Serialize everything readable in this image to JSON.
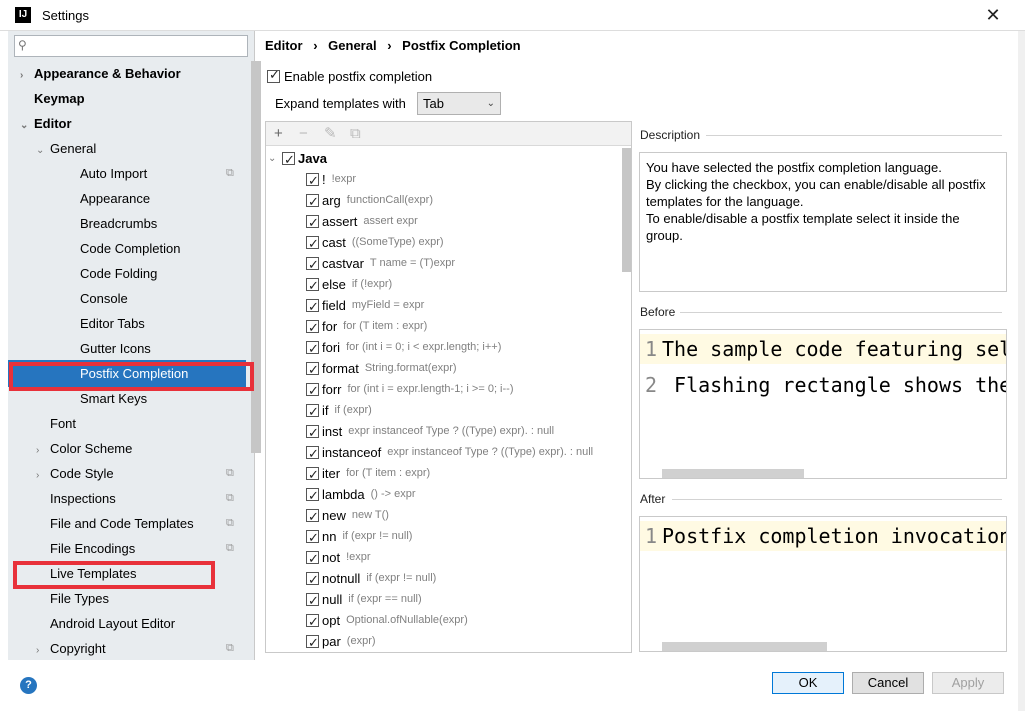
{
  "window": {
    "title": "Settings",
    "app_icon": "IJ",
    "close_label": "✕"
  },
  "search": {
    "placeholder": ""
  },
  "tree": [
    {
      "label": "Appearance & Behavior",
      "bold": true,
      "arrow": "›",
      "level": 0
    },
    {
      "label": "Keymap",
      "bold": true,
      "arrow": "",
      "level": 0
    },
    {
      "label": "Editor",
      "bold": true,
      "arrow": "⌄",
      "level": 0
    },
    {
      "label": "General",
      "bold": false,
      "arrow": "⌄",
      "level": 1
    },
    {
      "label": "Auto Import",
      "level": 2,
      "copy": true
    },
    {
      "label": "Appearance",
      "level": 2
    },
    {
      "label": "Breadcrumbs",
      "level": 2
    },
    {
      "label": "Code Completion",
      "level": 2
    },
    {
      "label": "Code Folding",
      "level": 2
    },
    {
      "label": "Console",
      "level": 2
    },
    {
      "label": "Editor Tabs",
      "level": 2
    },
    {
      "label": "Gutter Icons",
      "level": 2
    },
    {
      "label": "Postfix Completion",
      "level": 2,
      "selected": true
    },
    {
      "label": "Smart Keys",
      "level": 2
    },
    {
      "label": "Font",
      "level": 1
    },
    {
      "label": "Color Scheme",
      "level": 1,
      "arrow": "›"
    },
    {
      "label": "Code Style",
      "level": 1,
      "arrow": "›",
      "copy": true
    },
    {
      "label": "Inspections",
      "level": 1,
      "copy": true
    },
    {
      "label": "File and Code Templates",
      "level": 1,
      "copy": true
    },
    {
      "label": "File Encodings",
      "level": 1,
      "copy": true
    },
    {
      "label": "Live Templates",
      "level": 1
    },
    {
      "label": "File Types",
      "level": 1
    },
    {
      "label": "Android Layout Editor",
      "level": 1
    },
    {
      "label": "Copyright",
      "level": 1,
      "arrow": "›",
      "copy": true
    }
  ],
  "breadcrumb": {
    "part1": "Editor",
    "sep": "›",
    "part2": "General",
    "part3": "Postfix Completion"
  },
  "enable_label": "Enable postfix completion",
  "expand": {
    "label": "Expand templates with",
    "value": "Tab"
  },
  "toolbar": {
    "add": "+",
    "remove": "−",
    "edit": "✎",
    "copy": "⧉"
  },
  "java_group": "Java",
  "templates": [
    {
      "key": "!",
      "desc": "!expr"
    },
    {
      "key": "arg",
      "desc": "functionCall(expr)"
    },
    {
      "key": "assert",
      "desc": "assert expr"
    },
    {
      "key": "cast",
      "desc": "((SomeType) expr)"
    },
    {
      "key": "castvar",
      "desc": "T name = (T)expr"
    },
    {
      "key": "else",
      "desc": "if (!expr)"
    },
    {
      "key": "field",
      "desc": "myField = expr"
    },
    {
      "key": "for",
      "desc": "for (T item : expr)"
    },
    {
      "key": "fori",
      "desc": "for (int i = 0; i < expr.length; i++)"
    },
    {
      "key": "format",
      "desc": "String.format(expr)"
    },
    {
      "key": "forr",
      "desc": "for (int i = expr.length-1; i >= 0; i--)"
    },
    {
      "key": "if",
      "desc": "if (expr)"
    },
    {
      "key": "inst",
      "desc": "expr instanceof Type ? ((Type) expr). : null"
    },
    {
      "key": "instanceof",
      "desc": "expr instanceof Type ? ((Type) expr). : null"
    },
    {
      "key": "iter",
      "desc": "for (T item : expr)"
    },
    {
      "key": "lambda",
      "desc": "() -> expr"
    },
    {
      "key": "new",
      "desc": "new T()"
    },
    {
      "key": "nn",
      "desc": "if (expr != null)"
    },
    {
      "key": "not",
      "desc": "!expr"
    },
    {
      "key": "notnull",
      "desc": "if (expr != null)"
    },
    {
      "key": "null",
      "desc": "if (expr == null)"
    },
    {
      "key": "opt",
      "desc": "Optional.ofNullable(expr)"
    },
    {
      "key": "par",
      "desc": "(expr)"
    }
  ],
  "description": {
    "label": "Description",
    "lines": [
      "You have selected the postfix completion language.",
      "By clicking the checkbox, you can enable/disable all postfix",
      "templates for the language.",
      "To enable/disable a postfix template select it inside the",
      "group."
    ]
  },
  "before": {
    "label": "Before",
    "lines": [
      {
        "num": "1",
        "text": "The sample code featuring sel"
      },
      {
        "num": "2",
        "text": " Flashing rectangle shows the"
      }
    ]
  },
  "after": {
    "label": "After",
    "lines": [
      {
        "num": "1",
        "text": "Postfix completion invocation"
      }
    ]
  },
  "buttons": {
    "ok": "OK",
    "cancel": "Cancel",
    "apply": "Apply",
    "help": "?"
  }
}
